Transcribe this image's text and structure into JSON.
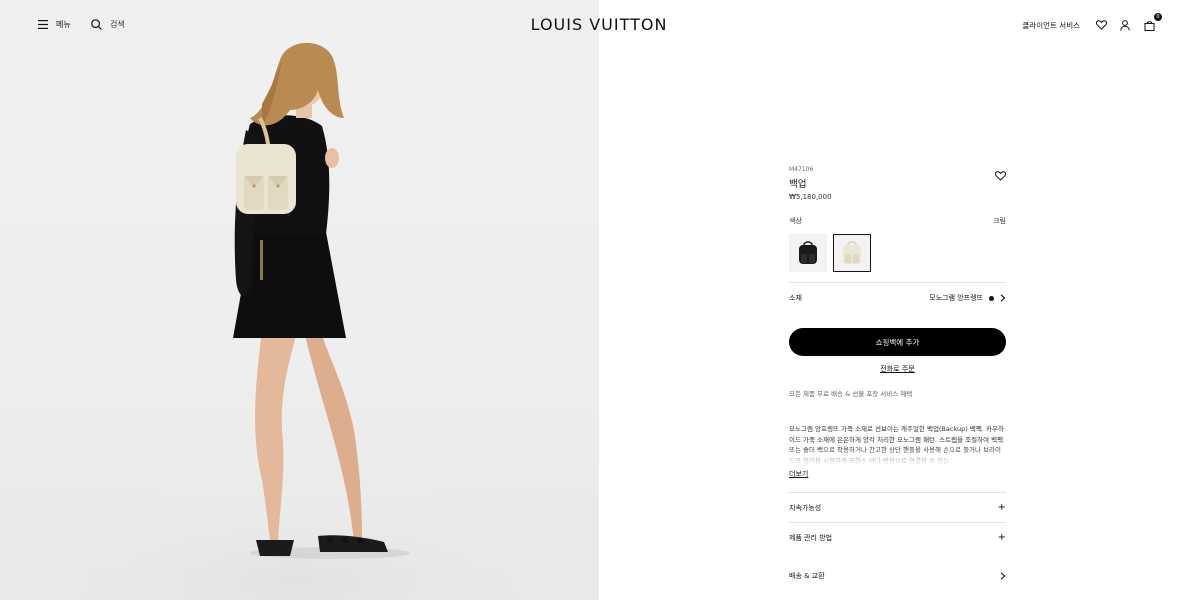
{
  "header": {
    "menu_label": "메뉴",
    "search_label": "검색",
    "logo": "LOUIS VUITTON",
    "client_service": "클라이언트 서비스",
    "cart_count": "0"
  },
  "product": {
    "sku": "M47106",
    "name": "백업",
    "price": "₩5,180,000",
    "color_label": "색상",
    "size_label": "크림",
    "swatches": [
      {
        "name": "black",
        "color": "#1a1a1a"
      },
      {
        "name": "cream",
        "color": "#ece6d6"
      }
    ],
    "material_label": "소재",
    "material_value": "모노그램 앙프렝뜨",
    "add_to_bag": "쇼핑백에 추가",
    "phone_order": "전화로 주문",
    "benefit": "모든 제품 무료 배송 & 선물 포장 서비스 혜택",
    "description": "모노그램 앙프렝뜨 가죽 소재로 선보이는 캐주얼한 백업(Backup) 백팩. 카우하이드 가죽 소재에 은은하게 양각 처리한 모노그램 패턴. 스트랩을 조절하여 백팩 또는 숄더 백으로 착용하거나 간고한 상단 핸들을 사용해 손으로 들거나 브라이드의 형이을 시원하게 표현스 바다 방향으로 연결할 수 있는",
    "more": "더보기",
    "accordions": [
      {
        "label": "지속가능성"
      },
      {
        "label": "제품 관리 방법"
      }
    ],
    "shipping": "배송 & 교환"
  },
  "colors": {
    "text": "#19110b",
    "button_bg": "#000000",
    "hero_bg": "#eeeeee"
  }
}
